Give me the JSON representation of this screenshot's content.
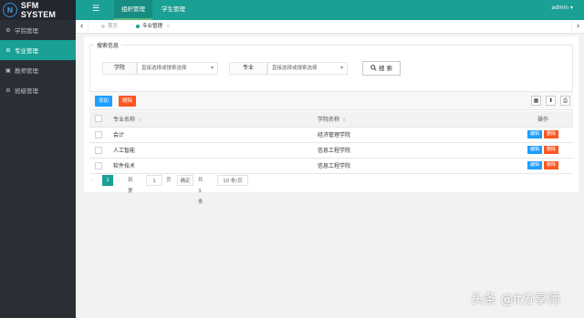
{
  "app": {
    "logo_letter": "N",
    "title": "SFM SYSTEM"
  },
  "sidebar": {
    "items": [
      {
        "label": "学院管理",
        "icon": "gear-icon",
        "glyph": "⚙"
      },
      {
        "label": "专业管理",
        "icon": "gear-icon",
        "glyph": "⚙"
      },
      {
        "label": "教师管理",
        "icon": "briefcase-icon",
        "glyph": "▣"
      },
      {
        "label": "班级管理",
        "icon": "gear-icon",
        "glyph": "⚙"
      }
    ],
    "active_index": 1
  },
  "header": {
    "menu_icon": "☰",
    "tabs": [
      "组织管理",
      "学生管理"
    ],
    "active_tab": 0,
    "user": "admin ▾"
  },
  "page_tabs": {
    "left_arrow": "‹",
    "right_arrow": "›",
    "items": [
      {
        "label": "首页"
      },
      {
        "label": "专业管理",
        "close": "×"
      }
    ],
    "active_index": 1
  },
  "search": {
    "legend": "搜索信息",
    "college_label": "学院",
    "college_placeholder": "直接选择或搜索选择",
    "major_label": "专业",
    "major_placeholder": "直接选择或搜索选择",
    "caret": "▾",
    "button": "搜 索",
    "search_icon": "search-icon"
  },
  "toolbar": {
    "add": "添加",
    "delete": "删除",
    "icons": [
      "columns-icon",
      "export-icon",
      "print-icon"
    ],
    "icon_glyphs": [
      "▦",
      "⬆",
      "⎙"
    ]
  },
  "table": {
    "columns": [
      "专业名称",
      "学院名称",
      "操作"
    ],
    "sort_glyph": "⇕",
    "rows": [
      {
        "major": "会计",
        "college": "经济管理学院"
      },
      {
        "major": "人工智能",
        "college": "信息工程学院"
      },
      {
        "major": "软件技术",
        "college": "信息工程学院"
      }
    ],
    "edit_label": "编辑",
    "delete_label": "删除"
  },
  "pagination": {
    "prev": "‹",
    "current_page": "1",
    "next": "›",
    "goto_label": "到第",
    "goto_value": "1",
    "page_unit": "页",
    "confirm": "确定",
    "total": "共 3 条",
    "page_size": "10 条/页"
  },
  "colors": {
    "accent": "#1aa094",
    "sidebar_bg": "#2a2f36",
    "blue_button": "#1e9fff",
    "red_button": "#ff5722"
  },
  "watermark": "头条 @it分享师"
}
